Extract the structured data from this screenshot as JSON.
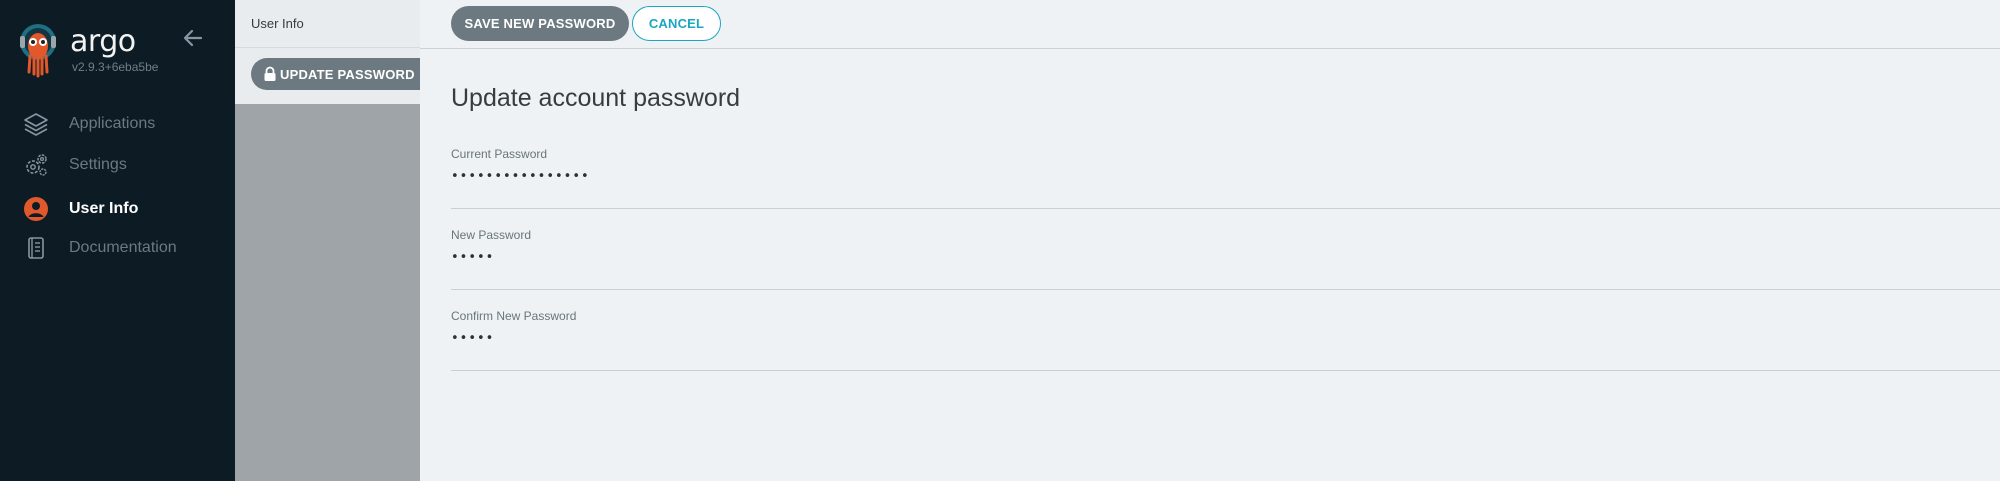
{
  "sidebar": {
    "brand": "argo",
    "version": "v2.9.3+6eba5be",
    "collapse_icon": "arrow-left-icon",
    "items": [
      {
        "label": "Applications",
        "icon": "layers-icon",
        "active": false
      },
      {
        "label": "Settings",
        "icon": "gears-icon",
        "active": false
      },
      {
        "label": "User Info",
        "icon": "user-circle-icon",
        "active": true
      },
      {
        "label": "Documentation",
        "icon": "book-icon",
        "active": false
      }
    ]
  },
  "midpanel": {
    "title": "User Info",
    "update_password_label": "UPDATE PASSWORD"
  },
  "toolbar": {
    "save_label": "SAVE NEW PASSWORD",
    "cancel_label": "CANCEL"
  },
  "form": {
    "title": "Update account password",
    "current_password": {
      "label": "Current Password",
      "value": "••••••••••••••••"
    },
    "new_password": {
      "label": "New Password",
      "value": "•••••"
    },
    "confirm_password": {
      "label": "Confirm New Password",
      "value": "•••••"
    }
  },
  "colors": {
    "sidebar_bg": "#0d1c24",
    "accent": "#1ba7c1",
    "user_icon": "#e0582c",
    "button_gray": "#6d7980"
  }
}
